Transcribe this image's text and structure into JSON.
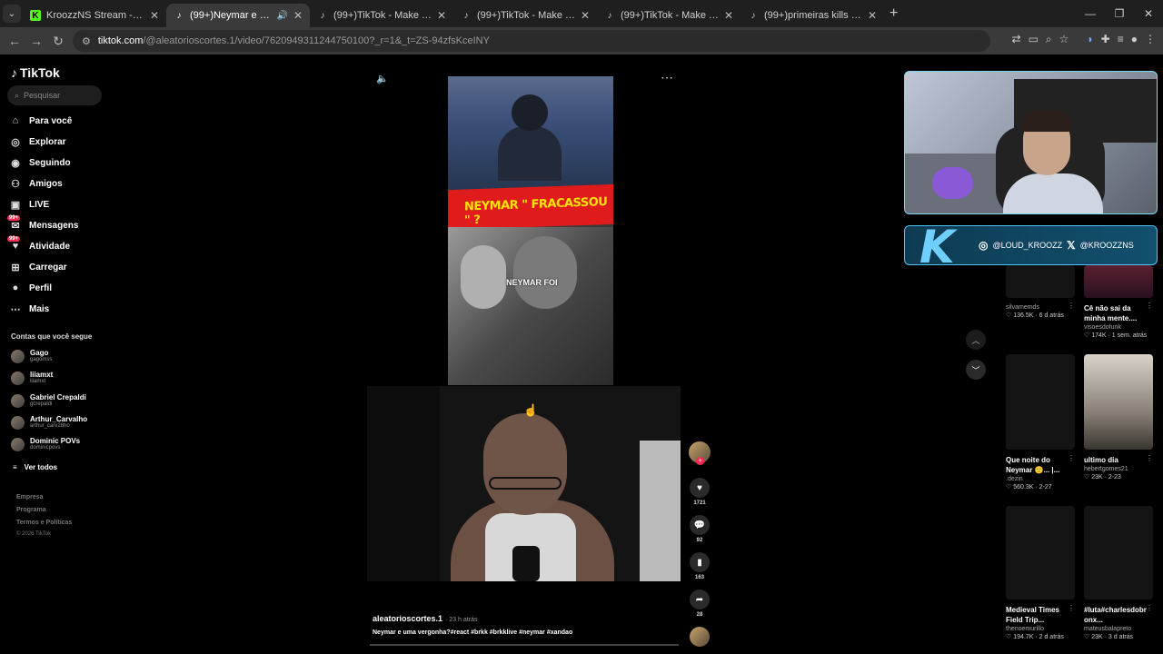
{
  "browser": {
    "tabs": [
      {
        "label": "KroozzNS Stream - Watch Live o",
        "icon": "kick-icon",
        "active": false
      },
      {
        "label": "(99+)Neymar e uma vergon",
        "icon": "tiktok-icon",
        "active": true
      },
      {
        "label": "(99+)TikTok - Make Your Day",
        "icon": "tiktok-icon",
        "active": false
      },
      {
        "label": "(99+)TikTok - Make Your Day",
        "icon": "tiktok-icon",
        "active": false
      },
      {
        "label": "(99+)TikTok - Make Your Day",
        "icon": "tiktok-icon",
        "active": false
      },
      {
        "label": "(99+)primeiras kills do dx pela",
        "icon": "tiktok-icon",
        "active": false
      }
    ],
    "url_host": "tiktok.com",
    "url_path": "/@aleatorioscortes.1/video/7620949311244750100?_r=1&_t=ZS-94zfsKceINY"
  },
  "sidebar": {
    "logo": "TikTok",
    "search_placeholder": "Pesquisar",
    "nav": [
      {
        "label": "Para você",
        "icon": "home-icon"
      },
      {
        "label": "Explorar",
        "icon": "compass-icon"
      },
      {
        "label": "Seguindo",
        "icon": "following-icon"
      },
      {
        "label": "Amigos",
        "icon": "friends-icon"
      },
      {
        "label": "LIVE",
        "icon": "live-icon"
      },
      {
        "label": "Mensagens",
        "icon": "messages-icon",
        "badge": "99+"
      },
      {
        "label": "Atividade",
        "icon": "activity-icon",
        "badge": "99+"
      },
      {
        "label": "Carregar",
        "icon": "upload-icon"
      },
      {
        "label": "Perfil",
        "icon": "profile-icon"
      },
      {
        "label": "Mais",
        "icon": "more-icon"
      }
    ],
    "following_title": "Contas que você segue",
    "following": [
      {
        "name": "Gago",
        "handle": "gagomss"
      },
      {
        "name": "liiamxt",
        "handle": "liiamxt"
      },
      {
        "name": "Gabriel Crepaldi",
        "handle": "gcrepaldi"
      },
      {
        "name": "Arthur_Carvalho",
        "handle": "arthur_carv28ho"
      },
      {
        "name": "Dominic POVs",
        "handle": "dominicpovs"
      }
    ],
    "see_all": "Ver todos",
    "footer": [
      "Empresa",
      "Programa",
      "Termos e Políticas",
      "© 2026 TikTok"
    ]
  },
  "video": {
    "banner_text": "NEYMAR \" FRACASSOU \" ?",
    "overlay_text": "NEYMAR FOI",
    "author": "aleatorioscortes.1",
    "ago": "· 23 h atrás",
    "caption": "Neymar e uma vergonha?#react #brkk #brkklive #neymar #xandao",
    "likes": "1721",
    "comments": "92",
    "saves": "163",
    "shares": "28"
  },
  "overlay": {
    "instagram": "@LOUD_KROOZZ",
    "x": "@KROOZZNS",
    "k_logo": "K"
  },
  "recommendations": [
    {
      "title": "",
      "author": "silvamemds",
      "stats": "♡ 136.5K · 6 d atrás"
    },
    {
      "title": "Cê não sai da minha mente....",
      "author": "visoesdofunk",
      "stats": "♡ 174K · 1 sem. atrás"
    },
    {
      "title": "Que noite do Neymar 🙂... |...",
      "author": ".dezin",
      "stats": "♡ 560.3K · 2-27"
    },
    {
      "title": "ultimo dia",
      "author": "hebertgomes21",
      "stats": "♡ 23K · 2-23"
    },
    {
      "title": "Medieval Times Field Trip...",
      "author": "thenoemurillo",
      "stats": "♡ 194.7K · 2 d atrás"
    },
    {
      "title": "#luta#charlesdobr onx...",
      "author": "mateusbalapreto",
      "stats": "♡ 23K · 3 d atrás"
    }
  ]
}
